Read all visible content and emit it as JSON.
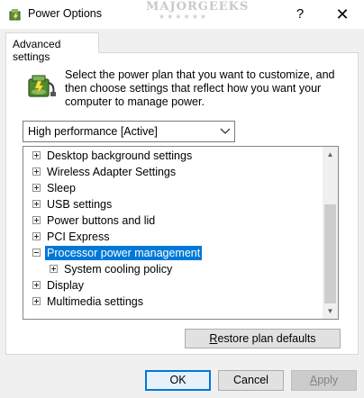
{
  "window": {
    "title": "Power Options",
    "help_glyph": "?",
    "close_glyph": "✕",
    "app_icon": "power-options-icon"
  },
  "watermark": {
    "text": "MAJORGEEKS",
    "stars": "★★★★★★"
  },
  "tab": {
    "label": "Advanced settings"
  },
  "description": "Select the power plan that you want to customize, and then choose settings that reflect how you want your computer to manage power.",
  "plan_select": {
    "value": "High performance [Active]"
  },
  "tree": {
    "items": [
      {
        "label": "Desktop background settings",
        "expander": "plus",
        "indent": 0,
        "selected": false
      },
      {
        "label": "Wireless Adapter Settings",
        "expander": "plus",
        "indent": 0,
        "selected": false
      },
      {
        "label": "Sleep",
        "expander": "plus",
        "indent": 0,
        "selected": false
      },
      {
        "label": "USB settings",
        "expander": "plus",
        "indent": 0,
        "selected": false
      },
      {
        "label": "Power buttons and lid",
        "expander": "plus",
        "indent": 0,
        "selected": false
      },
      {
        "label": "PCI Express",
        "expander": "plus",
        "indent": 0,
        "selected": false
      },
      {
        "label": "Processor power management",
        "expander": "minus",
        "indent": 0,
        "selected": true
      },
      {
        "label": "System cooling policy",
        "expander": "plus",
        "indent": 1,
        "selected": false
      },
      {
        "label": "Display",
        "expander": "plus",
        "indent": 0,
        "selected": false
      },
      {
        "label": "Multimedia settings",
        "expander": "plus",
        "indent": 0,
        "selected": false
      }
    ]
  },
  "buttons": {
    "restore_prefix": "R",
    "restore_rest": "estore plan defaults",
    "ok": "OK",
    "cancel": "Cancel",
    "apply_prefix": "A",
    "apply_rest": "pply"
  },
  "colors": {
    "selection": "#0078d7",
    "accent": "#0078d7"
  }
}
